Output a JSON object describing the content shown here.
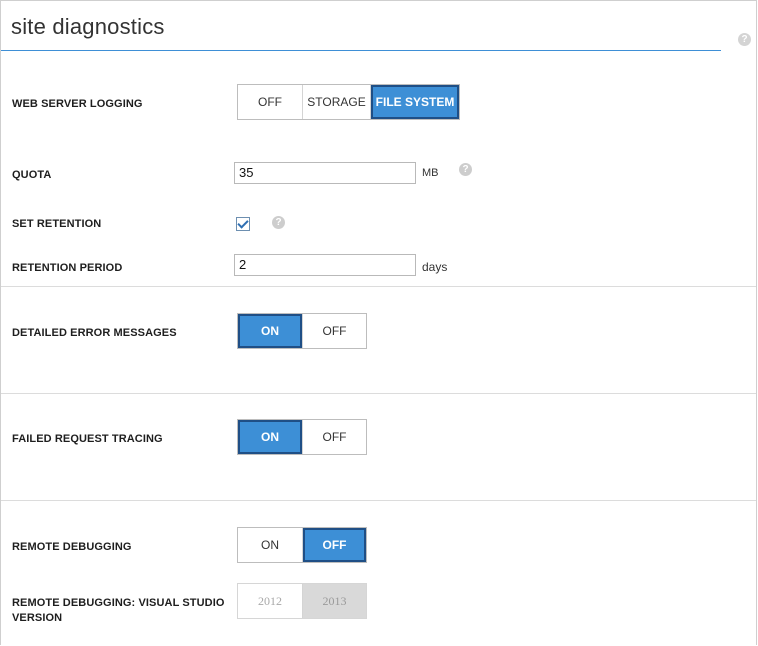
{
  "page": {
    "title": "site diagnostics"
  },
  "web_server_logging": {
    "label": "WEB SERVER LOGGING",
    "options": [
      "OFF",
      "STORAGE",
      "FILE SYSTEM"
    ],
    "selected": "FILE SYSTEM"
  },
  "quota": {
    "label": "QUOTA",
    "value": "35",
    "unit": "MB"
  },
  "set_retention": {
    "label": "SET RETENTION",
    "checked": true
  },
  "retention_period": {
    "label": "RETENTION PERIOD",
    "value": "2",
    "unit": "days"
  },
  "detailed_error_messages": {
    "label": "DETAILED ERROR MESSAGES",
    "options": [
      "ON",
      "OFF"
    ],
    "selected": "ON"
  },
  "failed_request_tracing": {
    "label": "FAILED REQUEST TRACING",
    "options": [
      "ON",
      "OFF"
    ],
    "selected": "ON"
  },
  "remote_debugging": {
    "label": "REMOTE DEBUGGING",
    "options": [
      "ON",
      "OFF"
    ],
    "selected": "OFF"
  },
  "remote_debugging_vs_version": {
    "label_line1": "REMOTE DEBUGGING: VISUAL STUDIO",
    "label_line2": "VERSION",
    "options": [
      "2012",
      "2013"
    ],
    "selected": "2013",
    "disabled": true
  },
  "icons": {
    "help": "help-icon",
    "check": "checkmark-icon"
  },
  "colors": {
    "accent": "#3d8fd6",
    "accent_border": "#1f4f86",
    "disabled_fill": "#d9d9d9"
  }
}
